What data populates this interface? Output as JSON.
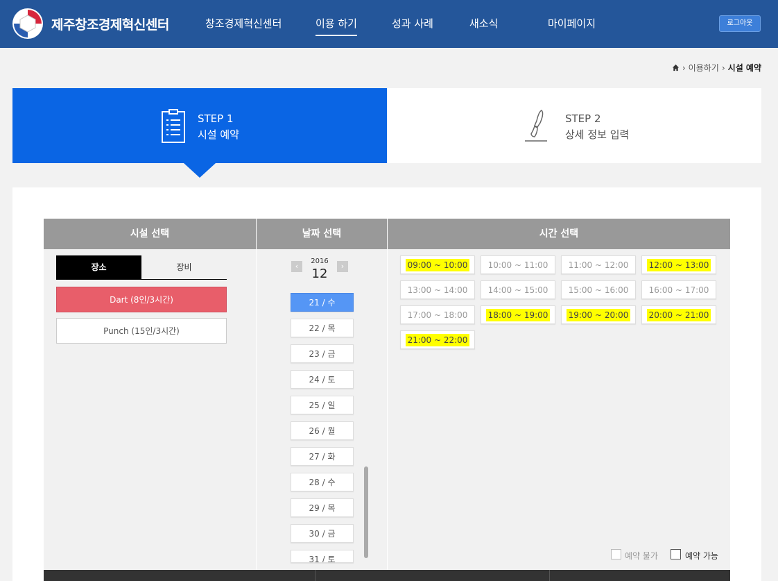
{
  "header": {
    "logo_text": "제주창조경제혁신센터",
    "nav": [
      "창조경제혁신센터",
      "이용 하기",
      "성과 사례",
      "새소식",
      "마이페이지"
    ],
    "logout_label": "로그아웃"
  },
  "breadcrumb": {
    "parent": "이용하기",
    "current": "시설 예약"
  },
  "steps": [
    {
      "num": "STEP 1",
      "title": "시설 예약"
    },
    {
      "num": "STEP 2",
      "title": "상세 정보 입력"
    }
  ],
  "columns": {
    "facility": "시설 선택",
    "date": "날짜 선택",
    "time": "시간 선택"
  },
  "facility": {
    "tabs": [
      "장소",
      "장비"
    ],
    "items": [
      "Dart (8인/3시간)",
      "Punch (15인/3시간)"
    ]
  },
  "date": {
    "prev_icon": "‹",
    "next_icon": "›",
    "year": "2016",
    "month": "12",
    "days": [
      "21 / 수",
      "22 / 목",
      "23 / 금",
      "24 / 토",
      "25 / 일",
      "26 / 월",
      "27 / 화",
      "28 / 수",
      "29 / 목",
      "30 / 금",
      "31 / 토"
    ]
  },
  "time": {
    "slots": [
      "09:00 ~ 10:00",
      "10:00 ~ 11:00",
      "11:00 ~ 12:00",
      "12:00 ~ 13:00",
      "13:00 ~ 14:00",
      "14:00 ~ 15:00",
      "15:00 ~ 16:00",
      "16:00 ~ 17:00",
      "17:00 ~ 18:00",
      "18:00 ~ 19:00",
      "19:00 ~ 20:00",
      "20:00 ~ 21:00",
      "21:00 ~ 22:00"
    ]
  },
  "legend": {
    "unavailable": "예약 불가",
    "available": "예약 가능"
  },
  "colors": {
    "header": "#24569a",
    "step_active": "#0a65e4",
    "selected_facility": "#e85e6a",
    "selected_date": "#5596f5",
    "highlight": "#ffff00"
  }
}
